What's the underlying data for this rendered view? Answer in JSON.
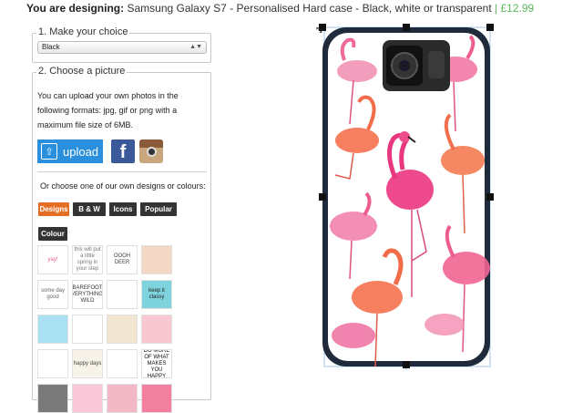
{
  "header": {
    "lead": "You are designing:",
    "product": "Samsung Galaxy S7 - Personalised Hard case - Black, white or transparent",
    "separator": "|",
    "price": "£12.99"
  },
  "step1": {
    "legend": "1. Make your choice",
    "select_value": "Black"
  },
  "step2": {
    "legend": "2. Choose a picture",
    "intro": "You can upload your own photos in the following formats: jpg, gif or png with a maximum file size of 6MB.",
    "upload_label": "upload",
    "facebook_letter": "f",
    "or_text": "Or choose one of our own designs or colours:",
    "tabs": [
      "Designs",
      "B & W",
      "Icons",
      "Popular",
      "Colour"
    ],
    "active_tab": "Designs"
  },
  "thumbnails": [
    {
      "text": "yay!",
      "bg": "#ffffff",
      "fg": "#e8608f"
    },
    {
      "text": "this will put a little spring in your step",
      "bg": "#ffffff",
      "fg": "#777"
    },
    {
      "text": "OOOH DEER",
      "bg": "#ffffff",
      "fg": "#444"
    },
    {
      "text": "",
      "bg": "#f3d7c4",
      "fg": "#c0392b"
    },
    {
      "text": "some day good",
      "bg": "#ffffff",
      "fg": "#666"
    },
    {
      "text": "BAREFOOT EVERYTHING'S WILD",
      "bg": "#ffffff",
      "fg": "#333"
    },
    {
      "text": "",
      "bg": "#ffffff",
      "fg": "#8bc34a"
    },
    {
      "text": "keep it classy",
      "bg": "#7fd3dc",
      "fg": "#222"
    },
    {
      "text": "",
      "bg": "#a9e0f2",
      "fg": "#e05a5a"
    },
    {
      "text": "",
      "bg": "#ffffff",
      "fg": "#e74c3c"
    },
    {
      "text": "",
      "bg": "#f0e6d2",
      "fg": "#555"
    },
    {
      "text": "",
      "bg": "#f7c8d2",
      "fg": "#c0392b"
    },
    {
      "text": "",
      "bg": "#ffffff",
      "fg": "#333"
    },
    {
      "text": "happy days",
      "bg": "#f7f3e8",
      "fg": "#444"
    },
    {
      "text": "",
      "bg": "#ffffff",
      "fg": "#e74c3c"
    },
    {
      "text": "DO MORE OF WHAT MAKES YOU HAPPY",
      "bg": "#ffffff",
      "fg": "#111"
    },
    {
      "text": "",
      "bg": "#7a7a7a",
      "fg": "#222"
    },
    {
      "text": "",
      "bg": "#f9c8d8",
      "fg": "#2aa8c9"
    },
    {
      "text": "",
      "bg": "#f2b8c6",
      "fg": "#e74c3c"
    },
    {
      "text": "",
      "bg": "#f07fa0",
      "fg": "#e74c3c"
    }
  ],
  "colors": {
    "accent_orange": "#e36d23",
    "upload_blue": "#2a8fdc",
    "price_green": "#5cb85c",
    "facebook_blue": "#3b5998"
  },
  "icons": {
    "upload": "upload-icon",
    "facebook": "facebook-icon",
    "instagram": "instagram-icon",
    "resize": "resize-icon"
  }
}
